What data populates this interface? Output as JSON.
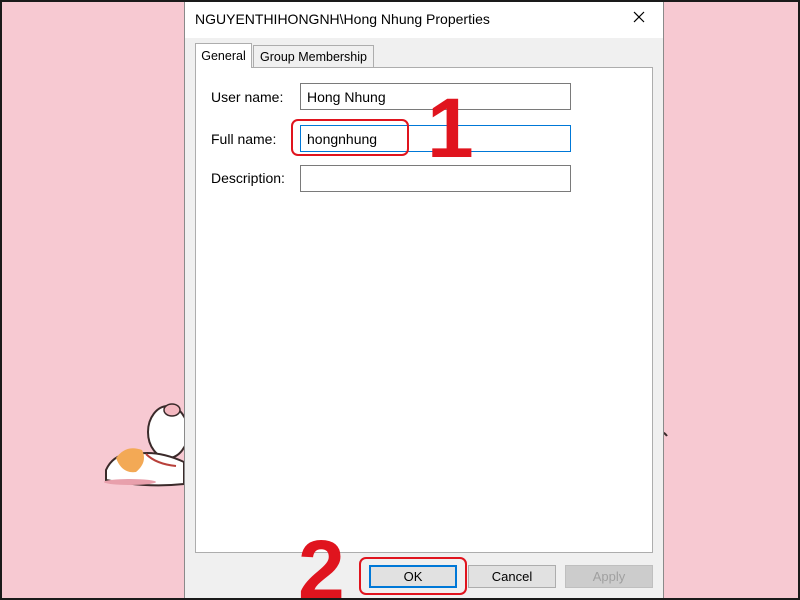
{
  "window": {
    "title": "NGUYENTHIHONGNH\\Hong Nhung Properties",
    "close_icon": "close-icon"
  },
  "tabs": [
    {
      "label": "General",
      "selected": true
    },
    {
      "label": "Group Membership",
      "selected": false
    }
  ],
  "form": {
    "username_label": "User name:",
    "username_value": "Hong Nhung",
    "fullname_label": "Full name:",
    "fullname_value": "hongnhung",
    "description_label": "Description:",
    "description_value": ""
  },
  "buttons": {
    "ok": "OK",
    "cancel": "Cancel",
    "apply": "Apply"
  },
  "annotations": {
    "step1": "1",
    "step2": "2"
  },
  "colors": {
    "wallpaper": "#f7c9d2",
    "annotation_red": "#e0141e",
    "focus_blue": "#0078d7"
  }
}
